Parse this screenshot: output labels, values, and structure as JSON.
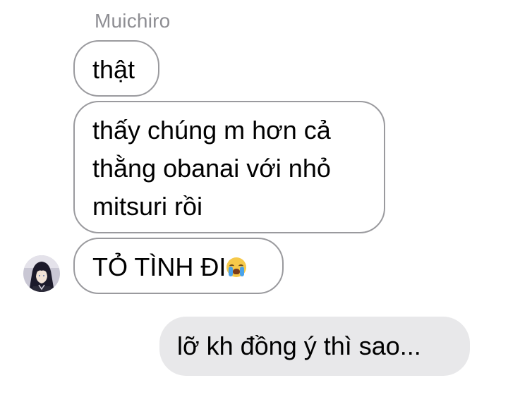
{
  "chat": {
    "sender_name": "Muichiro",
    "messages": [
      {
        "direction": "incoming",
        "lines": [
          "thật"
        ]
      },
      {
        "direction": "incoming",
        "lines": [
          "thấy chúng m hơn cả",
          "thằng obanai với nhỏ",
          "mitsuri rồi"
        ]
      },
      {
        "direction": "incoming",
        "lines": [
          "TỎ TÌNH ĐI"
        ],
        "emoji": "loudly-crying-face-icon",
        "show_avatar": true
      },
      {
        "direction": "outgoing",
        "lines": [
          "lỡ kh đồng ý thì sao..."
        ]
      }
    ]
  },
  "colors": {
    "incoming_border": "#9a9a9e",
    "incoming_background": "#ffffff",
    "outgoing_background": "#e8e8ea",
    "sender_name": "#8e8e93",
    "text": "#000000"
  }
}
